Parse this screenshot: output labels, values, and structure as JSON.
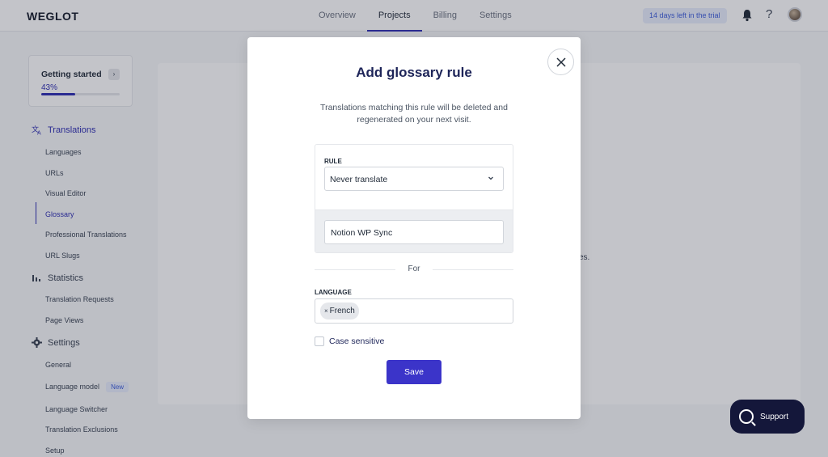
{
  "app": {
    "logo": "WEGLOT"
  },
  "topnav": {
    "items": [
      {
        "label": "Overview"
      },
      {
        "label": "Projects"
      },
      {
        "label": "Billing"
      },
      {
        "label": "Settings"
      }
    ],
    "active": "Projects",
    "trial_text": "14 days left in the trial",
    "help_label": "?"
  },
  "getting_started": {
    "title": "Getting started",
    "arrow": "›",
    "percent": "43%",
    "progress_fraction": 0.43
  },
  "sidebar": {
    "translations": {
      "label": "Translations",
      "icon": "translate-icon",
      "items": [
        {
          "label": "Languages"
        },
        {
          "label": "URLs"
        },
        {
          "label": "Visual Editor"
        },
        {
          "label": "Glossary"
        },
        {
          "label": "Professional Translations"
        },
        {
          "label": "URL Slugs"
        }
      ],
      "active_item": "Glossary"
    },
    "statistics": {
      "label": "Statistics",
      "icon": "bar-chart-icon",
      "items": [
        {
          "label": "Translation Requests"
        },
        {
          "label": "Page Views"
        }
      ]
    },
    "settings": {
      "label": "Settings",
      "icon": "gear-icon",
      "items": [
        {
          "label": "General"
        },
        {
          "label": "Language model",
          "badge": "New"
        },
        {
          "label": "Language Switcher"
        },
        {
          "label": "Translation Exclusions"
        },
        {
          "label": "Setup"
        }
      ]
    }
  },
  "main": {
    "fragment_text": "es."
  },
  "modal": {
    "title": "Add glossary rule",
    "description": "Translations matching this rule will be deleted and regenerated on your next visit.",
    "rule_label": "RULE",
    "rule_value": "Never translate",
    "term_value": "Notion WP Sync",
    "for_label": "For",
    "language_label": "LANGUAGE",
    "languages": [
      {
        "label": "French",
        "remove": "×"
      }
    ],
    "case_sensitive_label": "Case sensitive",
    "case_sensitive_checked": false,
    "save_label": "Save",
    "close_icon": "close-icon"
  },
  "support": {
    "label": "Support"
  },
  "colors": {
    "accent": "#2b2bb2",
    "primary_button": "#3b34c9",
    "modal_title": "#1e2559",
    "support_bg": "#14173a"
  }
}
